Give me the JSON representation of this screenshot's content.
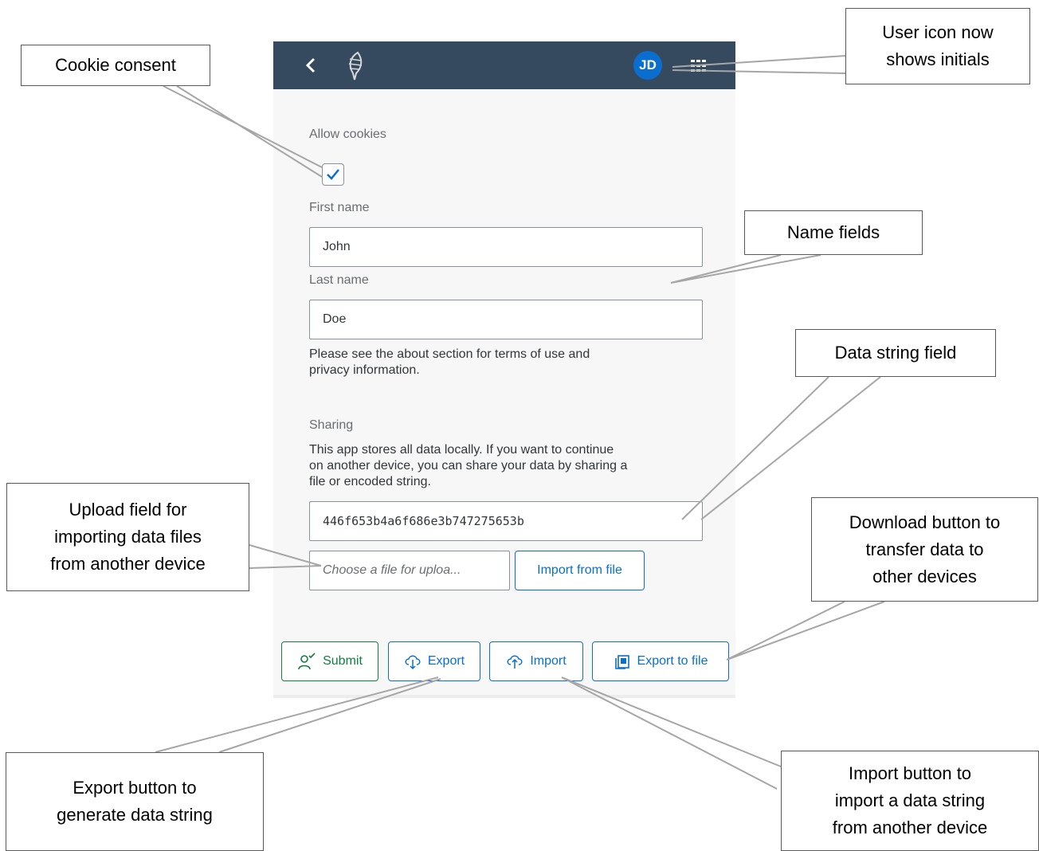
{
  "shellbar": {
    "avatar_initials": "JD",
    "icons": [
      "back-chevron-icon",
      "app-logo-icon",
      "app-grid-icon"
    ],
    "background": "#354a5f",
    "avatar_color": "#0a6ed1"
  },
  "form": {
    "cookies_label": "Allow cookies",
    "cookies_checked": true,
    "first_name_label": "First name",
    "first_name_value": "John",
    "last_name_label": "Last name",
    "last_name_value": "Doe",
    "terms_line1": "Please see the about section for terms of use and",
    "terms_line2": "privacy information."
  },
  "sharing": {
    "title": "Sharing",
    "desc_line1": "This app stores all data locally. If you want to continue",
    "desc_line2": "on another device, you can share your data by sharing a",
    "desc_line3": "file or encoded string.",
    "data_string": "446f653b4a6f686e3b747275653b",
    "file_placeholder": "Choose a file for uploa...",
    "import_file_label": "Import from file"
  },
  "toolbar": {
    "submit_label": "Submit",
    "export_label": "Export",
    "import_label": "Import",
    "export_file_label": "Export to file"
  },
  "callouts": {
    "cookie": "Cookie consent",
    "user_icon_line1": "User icon now",
    "user_icon_line2": "shows initials",
    "name_fields": "Name fields",
    "data_string_field": "Data string field",
    "upload_line1": "Upload field for",
    "upload_line2": "importing data files",
    "upload_line3": "from another device",
    "download_line1": "Download button to",
    "download_line2": "transfer data to",
    "download_line3": "other devices",
    "export_line1": "Export button to",
    "export_line2": "generate data string",
    "import_line1": "Import button to",
    "import_line2": "import a data string",
    "import_line3": "from another device"
  }
}
